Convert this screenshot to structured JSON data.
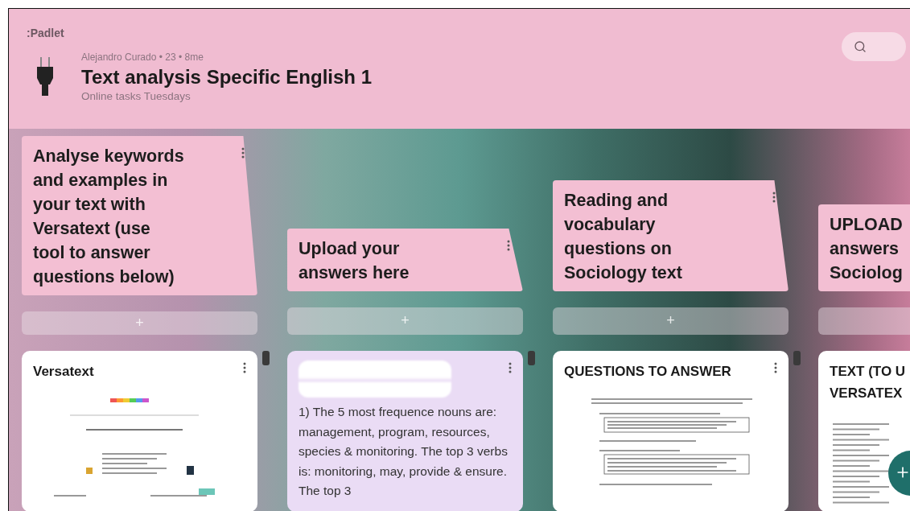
{
  "brand": ":Padlet",
  "board": {
    "meta": "Alejandro Curado • 23 • 8me",
    "title": "Text analysis Specific English 1",
    "subtitle": "Online tasks Tuesdays"
  },
  "columns": [
    {
      "title_lines": [
        "Analyse keywords",
        "and examples in",
        "your text with",
        "Versatext (use",
        "tool to answer",
        "questions below)"
      ],
      "add_label": "+",
      "cards": [
        {
          "kind": "website_preview",
          "title_lines": [
            "Versatext"
          ],
          "color": "#ffffff"
        }
      ]
    },
    {
      "title_lines": [
        "Upload your",
        "answers here"
      ],
      "add_label": "+",
      "cards": [
        {
          "kind": "text",
          "author_redacted": true,
          "body": "1) The 5 most frequence nouns are: management, program, resources, species & monitoring. The top 3 verbs is: monitoring, may, provide & ensure. The top 3",
          "color": "#eadcf5"
        }
      ]
    },
    {
      "title_lines": [
        "Reading and",
        "vocabulary",
        "questions on",
        "Sociology text"
      ],
      "add_label": "+",
      "cards": [
        {
          "kind": "worksheet_preview",
          "title_lines": [
            "QUESTIONS TO ANSWER"
          ],
          "color": "#ffffff"
        }
      ]
    },
    {
      "title_lines": [
        "UPLOAD",
        "answers",
        "Sociolog"
      ],
      "cards": [
        {
          "kind": "article_preview",
          "title_lines": [
            "TEXT (TO U",
            "VERSATEX"
          ],
          "color": "#ffffff"
        }
      ]
    }
  ]
}
